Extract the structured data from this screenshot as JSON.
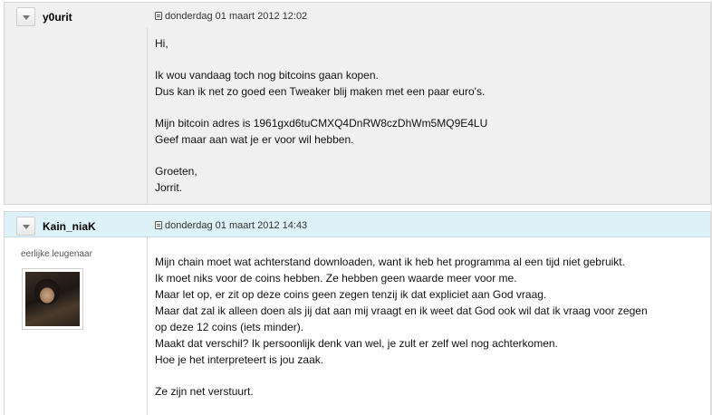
{
  "posts": [
    {
      "username": "y0urit",
      "timestamp": "donderdag 01 maart 2012 12:02",
      "body_lines": [
        "Hi,",
        "",
        "Ik wou vandaag toch nog bitcoins gaan kopen.",
        "Dus kan ik net zo goed een Tweaker blij maken met een paar euro's.",
        "",
        "Mijn bitcoin adres is 1961gxd6tuCMXQ4DnRW8czDhWm5MQ9E4LU",
        "Geef maar aan wat je er voor wil hebben.",
        "",
        "Groeten,",
        "Jorrit."
      ]
    },
    {
      "username": "Kain_niaK",
      "user_title": "eerlijke leugenaar",
      "timestamp": "donderdag 01 maart 2012 14:43",
      "body_lines": [
        "Mijn chain moet wat achterstand downloaden, want ik heb het programma al een tijd niet gebruikt.",
        "Ik moet niks voor de coins hebben. Ze hebben geen waarde meer voor me.",
        "Maar let op, er zit op deze coins geen zegen tenzij ik dat expliciet aan God vraag.",
        "Maar dat zal ik alleen doen als jij dat aan mij vraagt en ik weet dat God ook wil dat ik vraag voor zegen",
        "op deze 12 coins (iets minder).",
        "Maakt dat verschil? Ik persoonlijk denk van wel, je zult er zelf wel nog achterkomen.",
        "Hoe je het interpreteert is jou zaak.",
        "",
        "Ze zijn net verstuurt."
      ]
    }
  ],
  "icons": {
    "collapse": "triangle-down-icon",
    "post": "document-icon"
  },
  "colors": {
    "post1_bg": "#f0f0f0",
    "post2_header_bg": "#dcf1f8",
    "border": "#d6d6d6"
  }
}
